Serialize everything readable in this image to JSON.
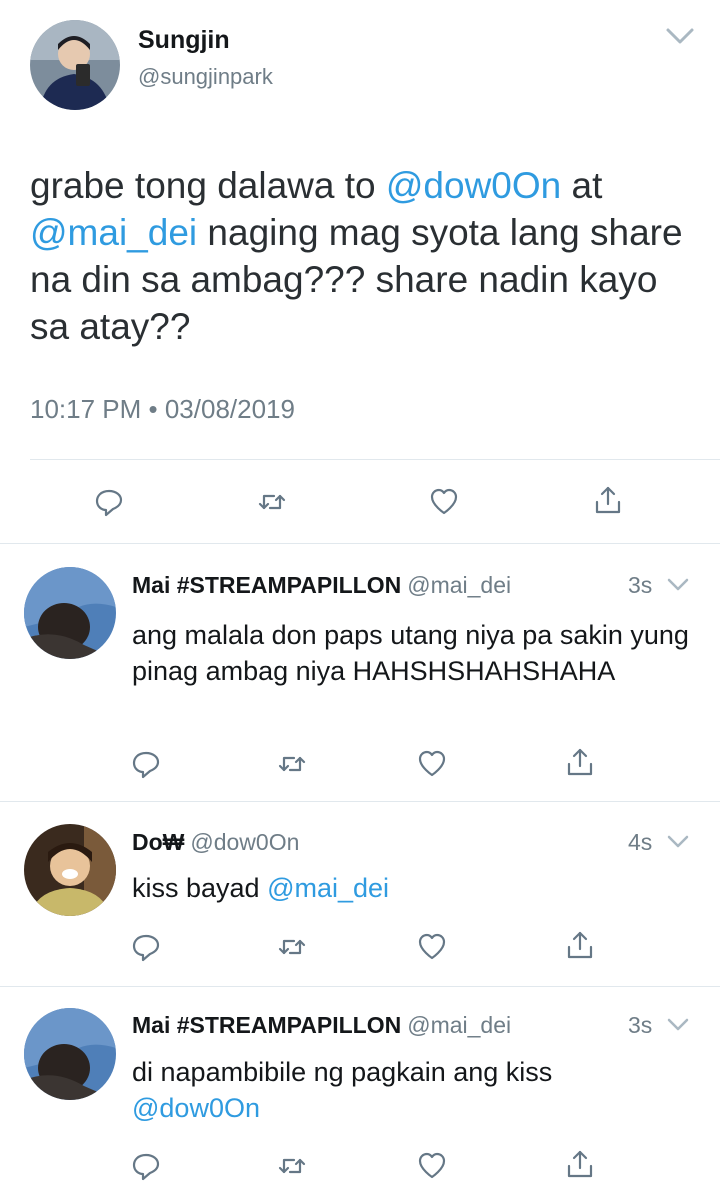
{
  "main_tweet": {
    "author_name": "Sungjin",
    "author_handle": "@sungjinpark",
    "text_parts": {
      "a": "grabe tong dalawa to ",
      "m1": "@dow0On",
      "b": " at",
      "m2": "@mai_dei",
      "c": " naging mag syota lang share na din sa ambag??? share nadin kayo sa atay??"
    },
    "timestamp": "10:17 PM • 03/08/2019"
  },
  "icons": {
    "reply": "reply-icon",
    "retweet": "retweet-icon",
    "like": "heart-icon",
    "share": "share-icon",
    "menu": "chevron-down-icon"
  },
  "colors": {
    "mention": "#2f9be0",
    "secondary_text": "#6f7d87",
    "divider": "#e1e8ed"
  },
  "replies": [
    {
      "author_name": "Mai #STREAMPAPILLON",
      "author_handle": "@mai_dei",
      "time": "3s",
      "text": "ang malala don paps utang niya pa sakin yung pinag ambag niya HAHSHSHAHSHAHA"
    },
    {
      "author_name": "Do₩",
      "author_handle": "@dow0On",
      "time": "4s",
      "text": "kiss bayad ",
      "mention": "@mai_dei"
    },
    {
      "author_name": "Mai #STREAMPAPILLON",
      "author_handle": "@mai_dei",
      "time": "3s",
      "text": "di napambibile ng pagkain ang kiss",
      "mention": "@dow0On"
    }
  ]
}
